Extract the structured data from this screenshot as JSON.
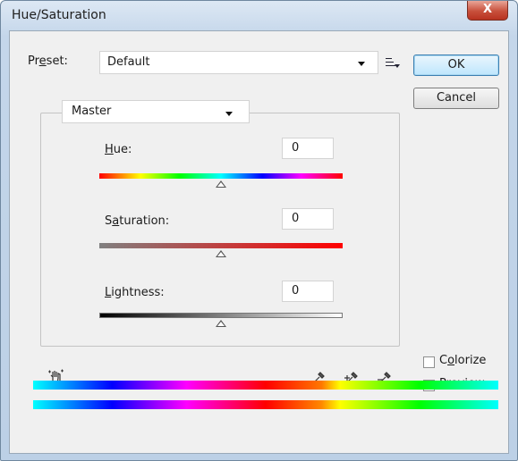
{
  "window": {
    "title": "Hue/Saturation",
    "close_glyph": "X"
  },
  "preset": {
    "label_prefix": "Pr",
    "label_underlined": "e",
    "label_suffix": "set:",
    "value": "Default"
  },
  "buttons": {
    "ok": "OK",
    "cancel": "Cancel"
  },
  "channel": {
    "value": "Master"
  },
  "sliders": {
    "hue": {
      "label_underlined": "H",
      "label_rest": "ue:",
      "value": "0"
    },
    "saturation": {
      "label_prefix": "S",
      "label_underlined": "a",
      "label_rest": "turation:",
      "value": "0"
    },
    "lightness": {
      "label_underlined": "L",
      "label_rest": "ightness:",
      "value": "0"
    }
  },
  "options": {
    "colorize": {
      "label_prefix": "C",
      "label_underlined": "o",
      "label_rest": "lorize",
      "checked": false
    },
    "preview": {
      "label_underlined": "P",
      "label_rest": "review",
      "checked": true
    }
  },
  "icons": {
    "target_adjust": "hand-target-icon",
    "eyedropper": "eyedropper-icon",
    "eyedropper_plus": "eyedropper-plus-icon",
    "eyedropper_minus": "eyedropper-minus-icon",
    "preset_menu": "preset-options-menu-icon"
  },
  "colors": {
    "title_bar": "#c4d6ea",
    "close_button": "#c8503c",
    "default_button": "#bee6fd",
    "dialog_bg": "#f0f0f0"
  }
}
